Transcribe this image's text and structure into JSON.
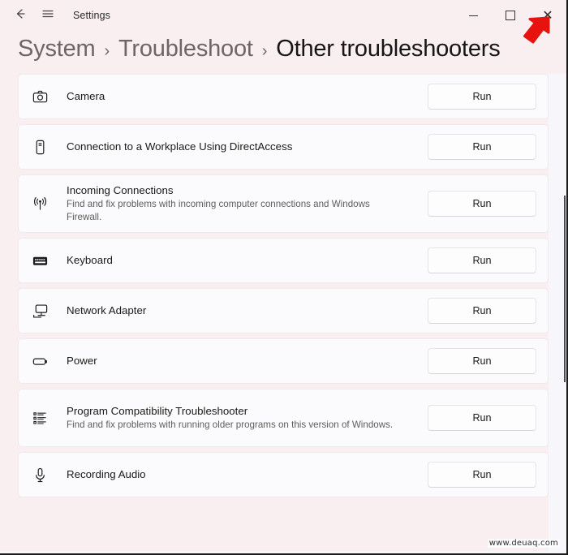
{
  "window": {
    "app_title": "Settings",
    "back_icon": "back-arrow-icon",
    "menu_icon": "hamburger-menu-icon",
    "controls": {
      "minimize": "minimize-icon",
      "maximize": "maximize-icon",
      "close": "✕"
    }
  },
  "breadcrumb": {
    "items": [
      {
        "label": "System",
        "current": false
      },
      {
        "label": "Troubleshoot",
        "current": false
      },
      {
        "label": "Other troubleshooters",
        "current": true
      }
    ],
    "separator": "›"
  },
  "troubleshooters": [
    {
      "icon": "camera-icon",
      "title": "Camera",
      "description": "",
      "action": "Run"
    },
    {
      "icon": "directaccess-device-icon",
      "title": "Connection to a Workplace Using DirectAccess",
      "description": "",
      "action": "Run"
    },
    {
      "icon": "broadcast-signal-icon",
      "title": "Incoming Connections",
      "description": "Find and fix problems with incoming computer connections and Windows Firewall.",
      "action": "Run"
    },
    {
      "icon": "keyboard-icon",
      "title": "Keyboard",
      "description": "",
      "action": "Run"
    },
    {
      "icon": "network-adapter-icon",
      "title": "Network Adapter",
      "description": "",
      "action": "Run"
    },
    {
      "icon": "battery-power-icon",
      "title": "Power",
      "description": "",
      "action": "Run"
    },
    {
      "icon": "program-list-icon",
      "title": "Program Compatibility Troubleshooter",
      "description": "Find and fix problems with running older programs on this version of Windows.",
      "action": "Run"
    },
    {
      "icon": "microphone-icon",
      "title": "Recording Audio",
      "description": "",
      "action": "Run"
    }
  ],
  "annotation": {
    "arrow_color": "#e8120f",
    "points_to": "close-button"
  },
  "watermark": {
    "text": "www.deuaq.com"
  },
  "colors": {
    "page_background": "#f9eef0",
    "card_background": "#fbfafc",
    "title_text": "#1a1a1a",
    "muted_text": "#5e5e5e",
    "breadcrumb_inactive": "#6e6569"
  }
}
